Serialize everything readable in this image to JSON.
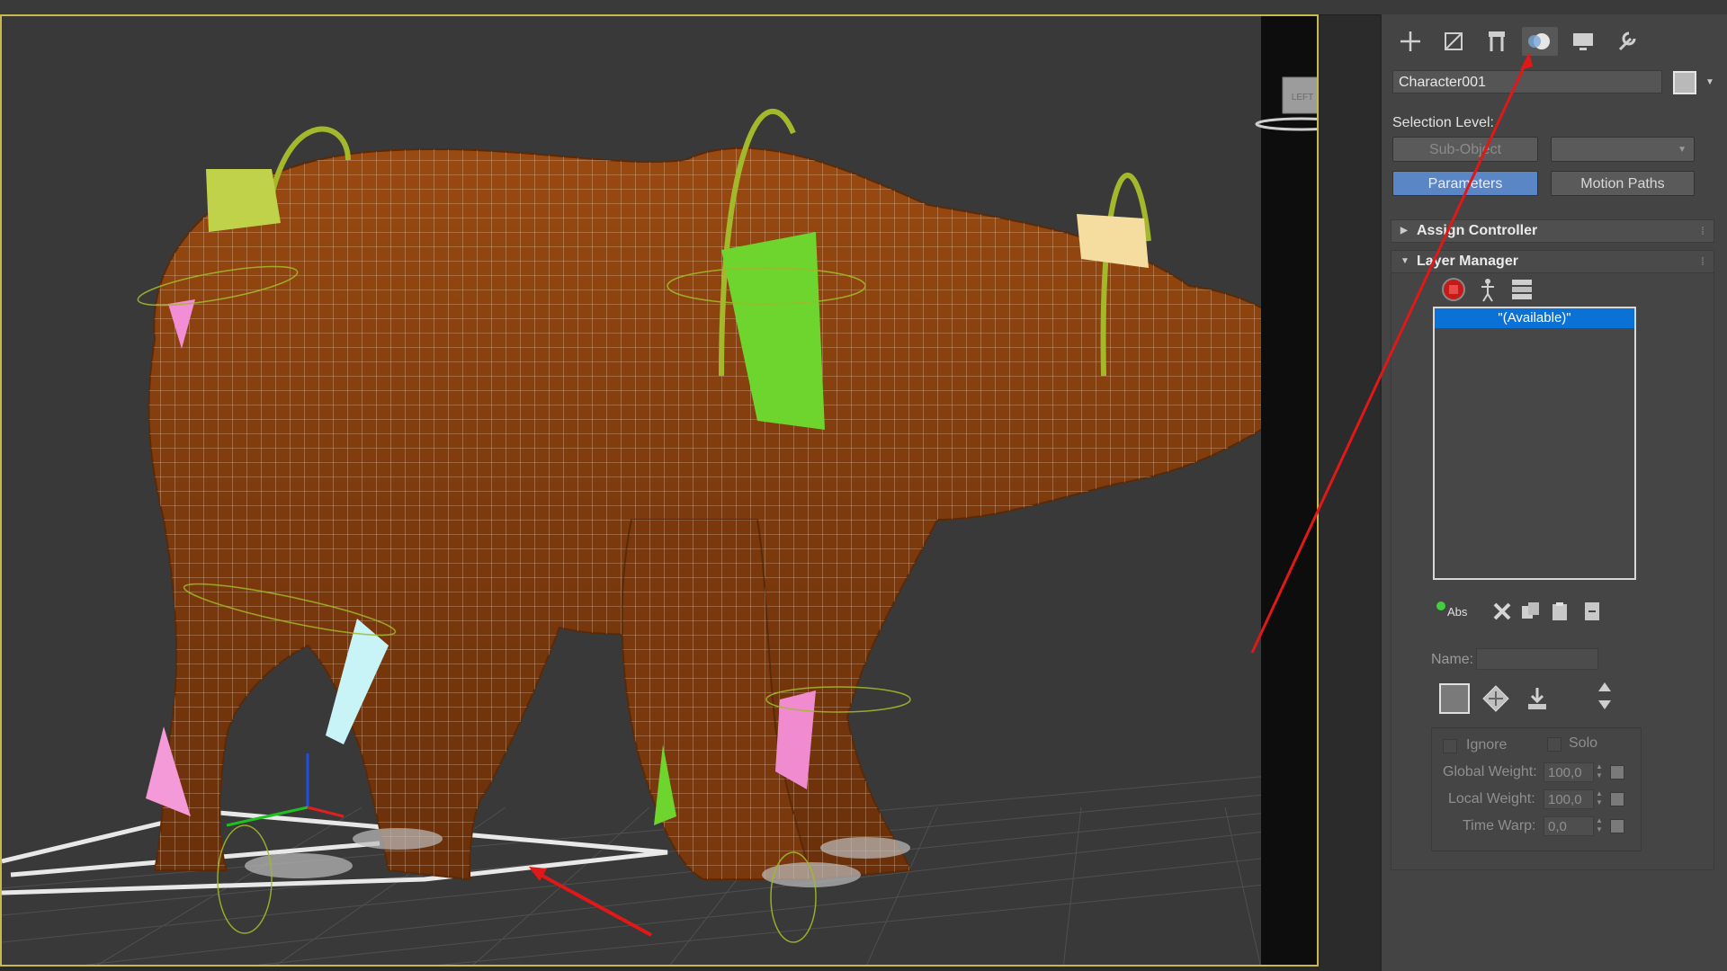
{
  "viewport": {
    "viewcube_label": "LEFT"
  },
  "command_panel": {
    "tabs": [
      {
        "icon": "create-plus-icon"
      },
      {
        "icon": "modify-icon"
      },
      {
        "icon": "hierarchy-icon"
      },
      {
        "icon": "motion-icon",
        "active": true
      },
      {
        "icon": "display-icon"
      },
      {
        "icon": "utilities-wrench-icon"
      }
    ],
    "object_name": "Character001",
    "selection_level_label": "Selection Level:",
    "sub_object_button": "Sub-Object",
    "parameters_button": "Parameters",
    "motion_paths_button": "Motion Paths",
    "assign_controller_rollout": "Assign Controller",
    "layer_manager_rollout": "Layer Manager",
    "layer_list": [
      "\"(Available)\""
    ],
    "abs_button_label": "Abs",
    "name_label": "Name:",
    "ignore_label": "Ignore",
    "solo_label": "Solo",
    "global_weight_label": "Global Weight:",
    "global_weight_value": "100,0",
    "local_weight_label": "Local Weight:",
    "local_weight_value": "100,0",
    "time_warp_label": "Time Warp:",
    "time_warp_value": "0,0"
  },
  "colors": {
    "viewport_border": "#c8b94a",
    "selected_item": "#0a72d6",
    "active_button": "#5b86c6",
    "annotation_arrow": "#e01818",
    "bear_fur": "#8a3f0e"
  }
}
